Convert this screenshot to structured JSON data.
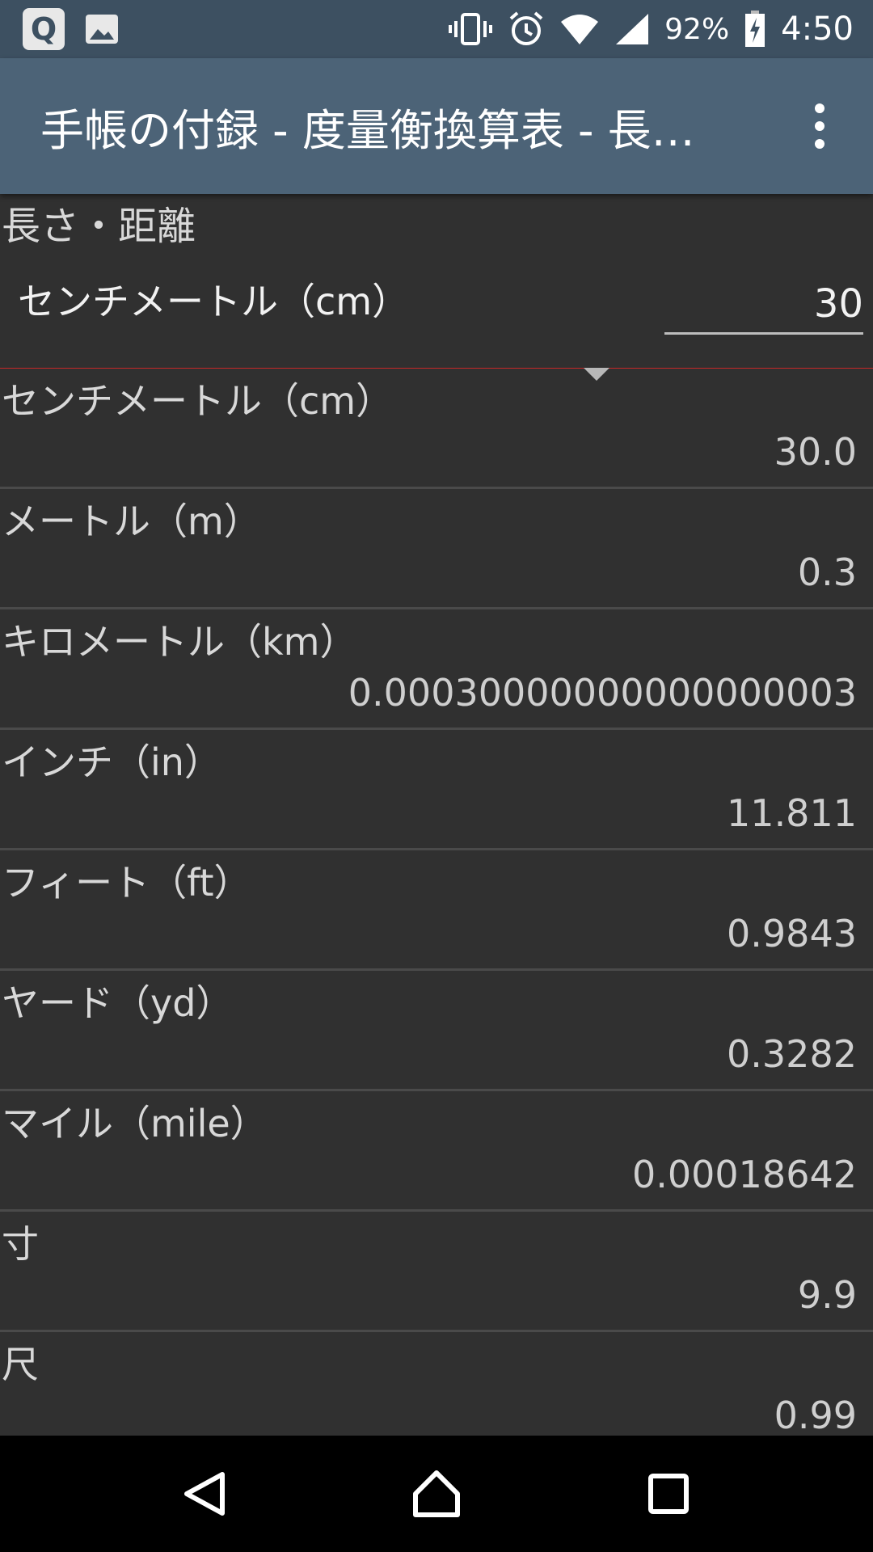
{
  "status_bar": {
    "battery": "92%",
    "time": "4:50"
  },
  "app_bar": {
    "title": "手帳の付録 - 度量衡換算表 - 長…"
  },
  "category": "長さ・距離",
  "input": {
    "unit": "センチメートル（cm）",
    "value": "30"
  },
  "results": [
    {
      "label": "センチメートル（cm）",
      "value": "30.0"
    },
    {
      "label": "メートル（m）",
      "value": "0.3"
    },
    {
      "label": "キロメートル（km）",
      "value": "0.00030000000000000003"
    },
    {
      "label": "インチ（in）",
      "value": "11.811"
    },
    {
      "label": "フィート（ft）",
      "value": "0.9843"
    },
    {
      "label": "ヤード（yd）",
      "value": "0.3282"
    },
    {
      "label": "マイル（mile）",
      "value": "0.00018642"
    },
    {
      "label": "寸",
      "value": "9.9"
    },
    {
      "label": "尺",
      "value": "0.99"
    }
  ],
  "icons": {
    "status_left": [
      "q-app-icon",
      "image-icon"
    ],
    "status_right": [
      "vibrate-icon",
      "alarm-icon",
      "wifi-icon",
      "signal-icon",
      "battery-charging-icon"
    ],
    "nav": [
      "back-icon",
      "home-icon",
      "recents-icon"
    ]
  },
  "colors": {
    "status_bar": "#3d5061",
    "app_bar": "#4c6377",
    "background": "#303030",
    "divider_accent": "#c62828"
  }
}
